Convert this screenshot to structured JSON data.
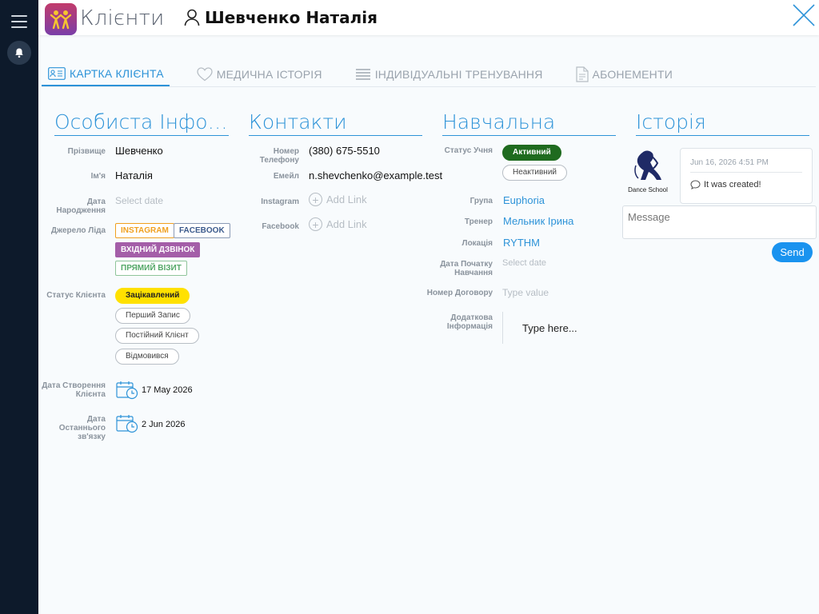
{
  "header": {
    "app_title": "Клієнти",
    "client_name": "Шевченко Наталія"
  },
  "tabs": [
    {
      "label": "КАРТКА КЛІЄНТА",
      "active": true,
      "icon": "id-card-icon"
    },
    {
      "label": "МЕДИЧНА ІСТОРІЯ",
      "active": false,
      "icon": "heart-icon"
    },
    {
      "label": "ІНДИВІДУАЛЬНІ ТРЕНУВАННЯ",
      "active": false,
      "icon": "list-icon"
    },
    {
      "label": "АБОНЕМЕНТИ",
      "active": false,
      "icon": "document-icon"
    }
  ],
  "sections": {
    "personal": "Особиста Інфор...",
    "contacts": "Контакти",
    "education": "Навчальна",
    "history": "Історія"
  },
  "personal": {
    "surname_label": "Прізвище",
    "surname": "Шевченко",
    "name_label": "Ім'я",
    "name": "Наталія",
    "birth_label_1": "Дата",
    "birth_label_2": "Народження",
    "birth_placeholder": "Select date",
    "lead_source_label": "Джерело Ліда",
    "lead_sources": [
      "INSTAGRAM",
      "FACEBOOK",
      "ВХІДНИЙ ДЗВІНОК",
      "ПРЯМИЙ ВІЗИТ"
    ],
    "client_status_label": "Статус Клієнта",
    "client_statuses": [
      "Зацікавлений",
      "Перший Запис",
      "Постійний Клієнт",
      "Відмовився"
    ],
    "created_label_1": "Дата Створення",
    "created_label_2": "Клієнта",
    "created_date": "17 May 2026",
    "last_contact_label_1": "Дата Останнього",
    "last_contact_label_2": "зв'язку",
    "last_contact_date": "2 Jun 2026"
  },
  "contacts": {
    "phone_label": "Номер Телефону",
    "phone": "(380) 675-5510",
    "email_label": "Емейл",
    "email": "n.shevchenko@example.test",
    "instagram_label": "Instagram",
    "facebook_label": "Facebook",
    "add_link": "Add Link"
  },
  "education": {
    "status_label": "Статус Учня",
    "status_active": "Активний",
    "status_inactive": "Неактивний",
    "group_label": "Група",
    "group": "Euphoria",
    "coach_label": "Тренер",
    "coach": "Мельник Ірина",
    "location_label": "Локація",
    "location": "RYTHM",
    "start_label_1": "Дата Початку",
    "start_label_2": "Навчання",
    "start_placeholder": "Select date",
    "contract_label": "Номер Договору",
    "contract_placeholder": "Type value",
    "extra_label_1": "Додаткова",
    "extra_label_2": "Інформація",
    "extra_placeholder": "Type here..."
  },
  "history": {
    "org_name": "Dance School",
    "entry_date": "Jun 16, 2026 4:51 PM",
    "entry_text": "It was created!",
    "message_placeholder": "Message",
    "send_label": "Send"
  },
  "colors": {
    "accent": "#2d93d8",
    "sidebar": "#0d1a2b",
    "instagram": "#f0a020",
    "facebook": "#3b5a8c",
    "incoming_call": "#a45ea8",
    "direct_visit": "#55a868",
    "interested": "#ffe100",
    "active": "#1f6b1f"
  }
}
